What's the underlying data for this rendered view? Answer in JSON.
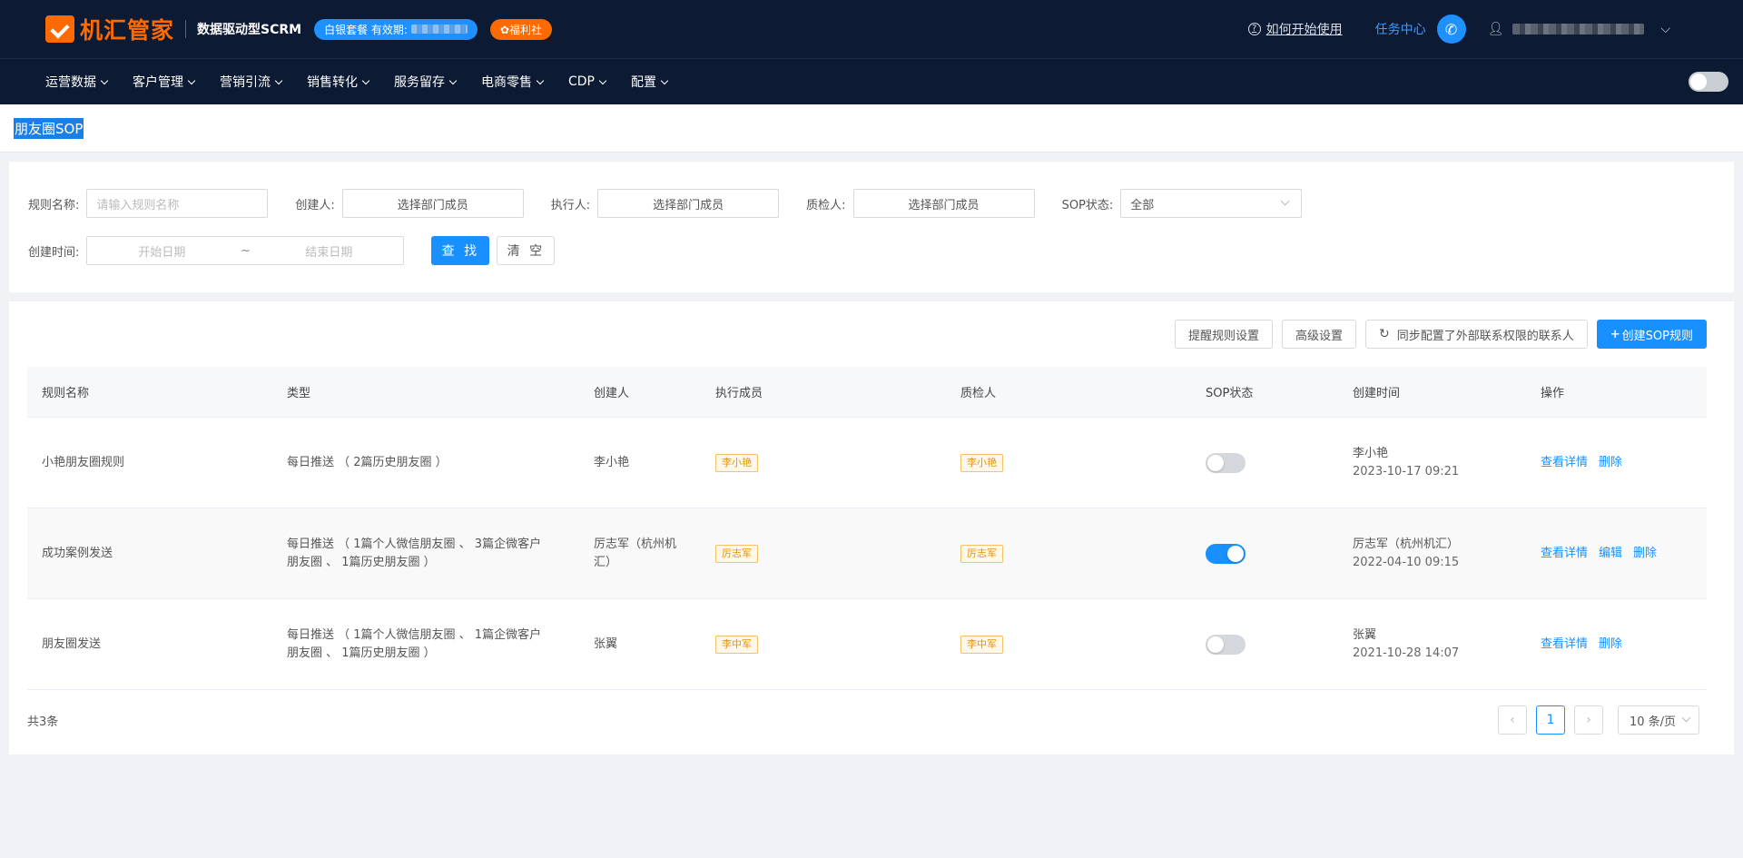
{
  "header": {
    "logo_text": "机汇管家",
    "slogan": "数据驱动型SCRM",
    "plan_badge": "白银套餐 有效期:",
    "welfare_badge": "福利社",
    "help_link": "如何开始使用",
    "task_center": "任务中心"
  },
  "nav": {
    "items": [
      "运营数据",
      "客户管理",
      "营销引流",
      "销售转化",
      "服务留存",
      "电商零售",
      "CDP",
      "配置"
    ]
  },
  "page": {
    "title": "朋友圈SOP"
  },
  "filters": {
    "rule_name_label": "规则名称:",
    "rule_name_placeholder": "请输入规则名称",
    "creator_label": "创建人:",
    "creator_value": "选择部门成员",
    "executor_label": "执行人:",
    "executor_value": "选择部门成员",
    "inspector_label": "质检人:",
    "inspector_value": "选择部门成员",
    "sop_status_label": "SOP状态:",
    "sop_status_value": "全部",
    "created_time_label": "创建时间:",
    "start_date_placeholder": "开始日期",
    "date_separator": "~",
    "end_date_placeholder": "结束日期",
    "search_button": "查 找",
    "clear_button": "清 空"
  },
  "toolbar": {
    "reminder_settings": "提醒规则设置",
    "advanced_settings": "高级设置",
    "sync_external": "同步配置了外部联系权限的联系人",
    "create_rule": "创建SOP规则"
  },
  "table": {
    "columns": [
      "规则名称",
      "类型",
      "创建人",
      "执行成员",
      "质检人",
      "SOP状态",
      "创建时间",
      "操作"
    ],
    "rows": [
      {
        "name": "小艳朋友圈规则",
        "type": "每日推送 （ 2篇历史朋友圈 ）",
        "creator": "李小艳",
        "executor": "李小艳",
        "inspector": "李小艳",
        "status_on": false,
        "created_by": "李小艳",
        "created_at": "2023-10-17 09:21",
        "actions": [
          "查看详情",
          "删除"
        ]
      },
      {
        "name": "成功案例发送",
        "type": "每日推送 （ 1篇个人微信朋友圈 、 3篇企微客户朋友圈 、 1篇历史朋友圈 ）",
        "creator": "厉志军（杭州机汇）",
        "executor": "厉志军",
        "inspector": "厉志军",
        "status_on": true,
        "created_by": "厉志军（杭州机汇）",
        "created_at": "2022-04-10 09:15",
        "actions": [
          "查看详情",
          "编辑",
          "删除"
        ]
      },
      {
        "name": "朋友圈发送",
        "type": "每日推送 （ 1篇个人微信朋友圈 、 1篇企微客户朋友圈 、 1篇历史朋友圈 ）",
        "creator": "张翼",
        "executor": "李中军",
        "inspector": "李中军",
        "status_on": false,
        "created_by": "张翼",
        "created_at": "2021-10-28 14:07",
        "actions": [
          "查看详情",
          "删除"
        ]
      }
    ]
  },
  "pagination": {
    "total": "共3条",
    "current_page": "1",
    "page_size": "10 条/页"
  },
  "colors": {
    "header_bg": "#0c1a33",
    "accent": "#1890ff",
    "brand_orange": "#ff6a00",
    "tag_orange": "#e6930c"
  }
}
